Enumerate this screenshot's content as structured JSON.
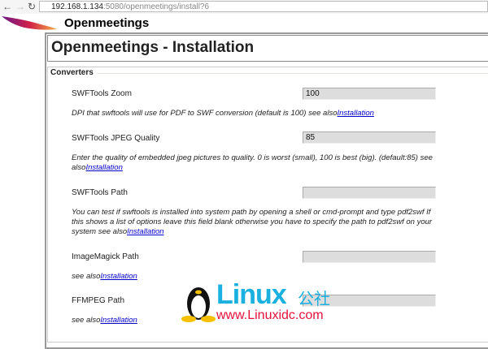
{
  "browser": {
    "url_host": "192.168.1.134",
    "url_rest": ":5080/openmeetings/install?6"
  },
  "header": {
    "brand": "Openmeetings"
  },
  "page": {
    "title": "Openmeetings - Installation",
    "legend": "Converters"
  },
  "fields": [
    {
      "label": "SWFTools Zoom",
      "value": "100",
      "desc": "DPI that swftools will use for PDF to SWF conversion (default is 100) see also",
      "link": "Installation"
    },
    {
      "label": "SWFTools JPEG Quality",
      "value": "85",
      "desc": "Enter the quality of embedded jpeg pictures to quality. 0 is worst (small), 100 is best (big). (default:85) see also",
      "link": "Installation"
    },
    {
      "label": "SWFTools Path",
      "value": "",
      "desc": "You can test if swftools is installed into system path by opening a shell or cmd-prompt and type pdf2swf If this shows a list of options leave this field blank otherwise you have to specify the path to pdf2swf on your system see also",
      "link": "Installation"
    },
    {
      "label": "ImageMagick Path",
      "value": "",
      "desc": "see also",
      "link": "Installation"
    },
    {
      "label": "FFMPEG Path",
      "value": "",
      "desc": "see also",
      "link": "Installation"
    }
  ],
  "watermark": {
    "name": "Linux",
    "cn": "公社",
    "url": "www.Linuxidc.com"
  }
}
